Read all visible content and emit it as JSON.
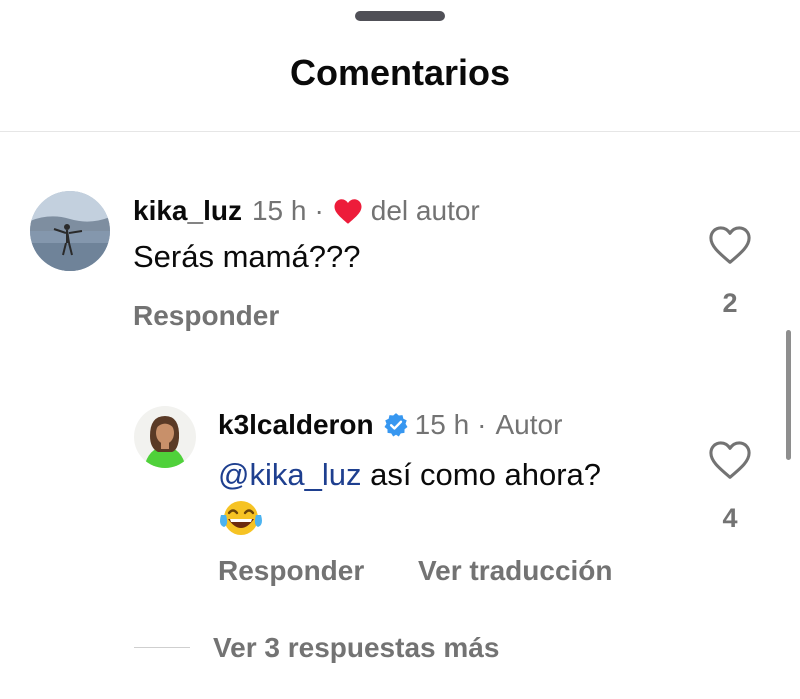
{
  "header": {
    "title": "Comentarios"
  },
  "comments": [
    {
      "username": "kika_luz",
      "time": "15 h",
      "separator": "·",
      "liked_by_author_label": "del autor",
      "text": "Serás mamá???",
      "reply_label": "Responder",
      "like_count": "2",
      "avatar_icon": "user-photo-icon"
    }
  ],
  "replies": [
    {
      "username": "k3lcalderon",
      "verified": true,
      "time": "15 h",
      "separator": "·",
      "author_label": "Autor",
      "mention": "@kika_luz",
      "text": "así como ahora?",
      "emoji": "😂",
      "reply_label": "Responder",
      "translate_label": "Ver traducción",
      "like_count": "4",
      "avatar_icon": "user-photo-icon"
    }
  ],
  "more_replies_label": "Ver 3 respuestas más",
  "colors": {
    "primary_text": "#0a0a0a",
    "secondary_text": "#737373",
    "mention": "#1e3f8f",
    "author_heart": "#ed1c3a",
    "verified_badge": "#3797f0"
  }
}
